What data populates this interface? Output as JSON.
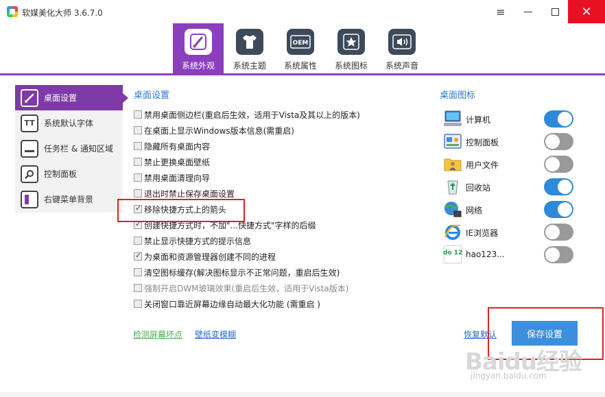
{
  "window": {
    "title": "软媒美化大师 3.6.7.0",
    "menu_glyph": "≡",
    "close_glyph": "✕"
  },
  "tabs": [
    {
      "label": "系统外观",
      "icon": "paintbrush-icon",
      "active": true
    },
    {
      "label": "系统主题",
      "icon": "tshirt-icon",
      "active": false
    },
    {
      "label": "系统属性",
      "icon": "oem-icon",
      "icon_text": "OEM",
      "active": false
    },
    {
      "label": "系统图标",
      "icon": "star-icon",
      "active": false
    },
    {
      "label": "系统声音",
      "icon": "speaker-icon",
      "active": false
    }
  ],
  "sidebar": {
    "items": [
      {
        "label": "桌面设置",
        "icon": "brush-icon",
        "active": true
      },
      {
        "label": "系统默认字体",
        "icon": "font-icon",
        "icon_text": "TT",
        "active": false
      },
      {
        "label": "任务栏 & 通知区域",
        "icon": "taskbar-icon",
        "active": false
      },
      {
        "label": "控制面板",
        "icon": "magnifier-icon",
        "active": false
      },
      {
        "label": "右键菜单背景",
        "icon": "context-menu-icon",
        "active": false
      }
    ]
  },
  "desktop_settings": {
    "title": "桌面设置",
    "options": [
      {
        "label": "禁用桌面侧边栏(重启后生效，适用于Vista及其以上的版本)",
        "checked": false,
        "disabled": false
      },
      {
        "label": "在桌面上显示Windows版本信息(需重启)",
        "checked": false,
        "disabled": false
      },
      {
        "label": "隐藏所有桌面内容",
        "checked": false,
        "disabled": false
      },
      {
        "label": "禁止更换桌面壁纸",
        "checked": false,
        "disabled": false
      },
      {
        "label": "禁用桌面清理向导",
        "checked": false,
        "disabled": false
      },
      {
        "label": "退出时禁止保存桌面设置",
        "checked": false,
        "disabled": false
      },
      {
        "label": "移除快捷方式上的箭头",
        "checked": true,
        "disabled": false
      },
      {
        "label": "创建快捷方式时，不加\"...快捷方式\"字样的后缀",
        "checked": true,
        "disabled": false
      },
      {
        "label": "禁止显示快捷方式的提示信息",
        "checked": false,
        "disabled": false
      },
      {
        "label": "为桌面和资源管理器创建不同的进程",
        "checked": true,
        "disabled": false
      },
      {
        "label": "清空图标缓存(解决图标显示不正常问题，重启后生效)",
        "checked": false,
        "disabled": false
      },
      {
        "label": "强制开启DWM玻璃效果(重启后生效，适用于Vista版本)",
        "checked": false,
        "disabled": true
      },
      {
        "label": "关闭窗口靠近屏幕边缘自动最大化功能 (需重启 )",
        "checked": false,
        "disabled": false
      }
    ]
  },
  "desktop_icons": {
    "title": "桌面图标",
    "items": [
      {
        "label": "计算机",
        "icon": "computer-icon",
        "on": true
      },
      {
        "label": "控制面板",
        "icon": "control-panel-icon",
        "on": false
      },
      {
        "label": "用户文件",
        "icon": "user-folder-icon",
        "on": false
      },
      {
        "label": "回收站",
        "icon": "recycle-bin-icon",
        "on": true
      },
      {
        "label": "网络",
        "icon": "network-icon",
        "on": true
      },
      {
        "label": "IE浏览器",
        "icon": "ie-icon",
        "on": false
      },
      {
        "label": "hao123...",
        "icon": "hao123-icon",
        "icon_text": "hdo 123",
        "on": false
      }
    ]
  },
  "footer": {
    "link_check_screen": "检测屏幕坏点",
    "link_wallpaper_blur": "壁纸变模糊",
    "link_restore": "恢复默认",
    "save_button": "保存设置"
  },
  "watermark": {
    "text": "Baidu经验",
    "sub": "jingyan.baidu.com"
  },
  "colors": {
    "accent_purple": "#8b3fbf",
    "sidebar_active": "#7e3aa8",
    "title_blue": "#2a7ad0",
    "toggle_on": "#2d8ad8",
    "save_button": "#3b8fdd",
    "close_red": "#e81123",
    "annotation_red": "#e02020"
  }
}
